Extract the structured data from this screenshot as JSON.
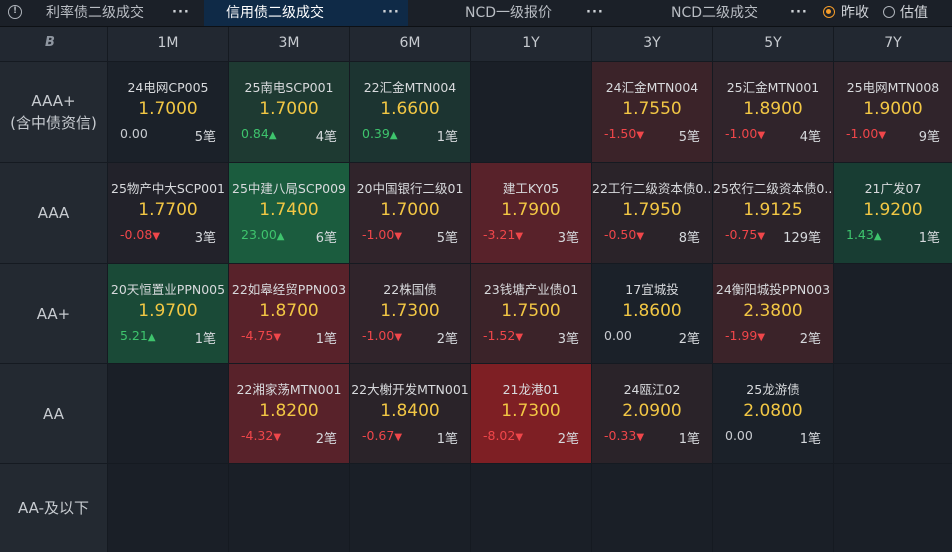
{
  "tabs": [
    {
      "label": "利率债二级成交",
      "more": "···",
      "active": false
    },
    {
      "label": "信用债二级成交",
      "more": "···",
      "active": true
    },
    {
      "label": "NCD一级报价",
      "more": "···",
      "active": false
    },
    {
      "label": "NCD二级成交",
      "more": "···",
      "active": false
    }
  ],
  "options": {
    "prev_close": "昨收",
    "valuation": "估值",
    "selected": "prev_close"
  },
  "corner_icon": "logo-b-icon",
  "columns": [
    "1M",
    "3M",
    "6M",
    "1Y",
    "3Y",
    "5Y",
    "7Y"
  ],
  "rows": [
    {
      "label": "AAA+",
      "sub": "(含中债资信)"
    },
    {
      "label": "AAA",
      "sub": ""
    },
    {
      "label": "AA+",
      "sub": ""
    },
    {
      "label": "AA",
      "sub": ""
    },
    {
      "label": "AA-及以下",
      "sub": ""
    }
  ],
  "colors": {
    "up": "#3ec46d",
    "down": "#f0464a",
    "yield": "#f2c744",
    "active_tab": "#0f2a47",
    "radio": "#f39c2a"
  },
  "cells": [
    [
      {
        "name": "24电网CP005",
        "yield": "1.7000",
        "change": "0.00",
        "dir": "flat",
        "count": "5笔",
        "bg": "#1b2129"
      },
      {
        "name": "25南电SCP001",
        "yield": "1.7000",
        "change": "0.84",
        "dir": "up",
        "count": "4笔",
        "bg": "#1e3a32"
      },
      {
        "name": "22汇金MTN004",
        "yield": "1.6600",
        "change": "0.39",
        "dir": "up",
        "count": "1笔",
        "bg": "#1c3431"
      },
      null,
      {
        "name": "24汇金MTN004",
        "yield": "1.7550",
        "change": "-1.50",
        "dir": "down",
        "count": "5笔",
        "bg": "#3b2329"
      },
      {
        "name": "25汇金MTN001",
        "yield": "1.8900",
        "change": "-1.00",
        "dir": "down",
        "count": "4笔",
        "bg": "#30242b"
      },
      {
        "name": "25电网MTN008",
        "yield": "1.9000",
        "change": "-1.00",
        "dir": "down",
        "count": "9笔",
        "bg": "#30242b"
      }
    ],
    [
      {
        "name": "25物产中大SCP001",
        "yield": "1.7700",
        "change": "-0.08",
        "dir": "down",
        "count": "3笔",
        "bg": "#22222a"
      },
      {
        "name": "25中建八局SCP009",
        "yield": "1.7400",
        "change": "23.00",
        "dir": "up",
        "count": "6笔",
        "bg": "#1b5c3e"
      },
      {
        "name": "20中国银行二级01",
        "yield": "1.7000",
        "change": "-1.00",
        "dir": "down",
        "count": "5笔",
        "bg": "#30242b"
      },
      {
        "name": "建工KY05",
        "yield": "1.7900",
        "change": "-3.21",
        "dir": "down",
        "count": "3笔",
        "bg": "#58222a"
      },
      {
        "name": "22工行二级资本债0...",
        "yield": "1.7950",
        "change": "-0.50",
        "dir": "down",
        "count": "8笔",
        "bg": "#2a2329"
      },
      {
        "name": "25农行二级资本债0...",
        "yield": "1.9125",
        "change": "-0.75",
        "dir": "down",
        "count": "129笔",
        "bg": "#2c2329"
      },
      {
        "name": "21广发07",
        "yield": "1.9200",
        "change": "1.43",
        "dir": "up",
        "count": "1笔",
        "bg": "#183d33"
      }
    ],
    [
      {
        "name": "20天恒置业PPN005",
        "yield": "1.9700",
        "change": "5.21",
        "dir": "up",
        "count": "1笔",
        "bg": "#1a4a37"
      },
      {
        "name": "22如皋经贸PPN003",
        "yield": "1.8700",
        "change": "-4.75",
        "dir": "down",
        "count": "1笔",
        "bg": "#58222a"
      },
      {
        "name": "22株国债",
        "yield": "1.7300",
        "change": "-1.00",
        "dir": "down",
        "count": "2笔",
        "bg": "#30242b"
      },
      {
        "name": "23钱塘产业债01",
        "yield": "1.7500",
        "change": "-1.52",
        "dir": "down",
        "count": "3笔",
        "bg": "#3b2329"
      },
      {
        "name": "17宜城投",
        "yield": "1.8600",
        "change": "0.00",
        "dir": "flat",
        "count": "2笔",
        "bg": "#1b2129"
      },
      {
        "name": "24衡阳城投PPN003",
        "yield": "2.3800",
        "change": "-1.99",
        "dir": "down",
        "count": "2笔",
        "bg": "#3b2329"
      },
      null
    ],
    [
      null,
      {
        "name": "22湘家荡MTN001",
        "yield": "1.8200",
        "change": "-4.32",
        "dir": "down",
        "count": "2笔",
        "bg": "#58222a"
      },
      {
        "name": "22大榭开发MTN001",
        "yield": "1.8400",
        "change": "-0.67",
        "dir": "down",
        "count": "1笔",
        "bg": "#2a2329"
      },
      {
        "name": "21龙港01",
        "yield": "1.7300",
        "change": "-8.02",
        "dir": "down",
        "count": "2笔",
        "bg": "#7e1f24"
      },
      {
        "name": "24瓯江02",
        "yield": "2.0900",
        "change": "-0.33",
        "dir": "down",
        "count": "1笔",
        "bg": "#2a2329"
      },
      {
        "name": "25龙游债",
        "yield": "2.0800",
        "change": "0.00",
        "dir": "flat",
        "count": "1笔",
        "bg": "#1b2129"
      },
      null
    ],
    [
      null,
      null,
      null,
      null,
      null,
      null,
      null
    ]
  ]
}
